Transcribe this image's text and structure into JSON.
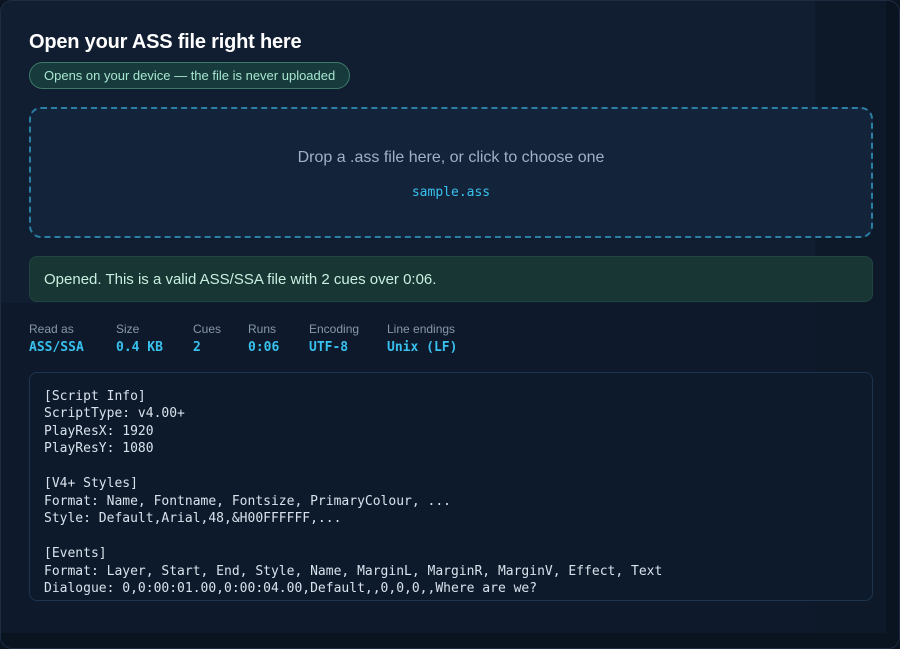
{
  "header": {
    "title": "Open your ASS file right here",
    "privacy_badge": "Opens on your device — the file is never uploaded"
  },
  "dropzone": {
    "prompt": "Drop a .ass file here, or click to choose one",
    "selected_file": "sample.ass"
  },
  "status": {
    "message": "Opened. This is a valid ASS/SSA file with 2 cues over 0:06."
  },
  "stats": [
    {
      "label": "Read as",
      "value": "ASS/SSA"
    },
    {
      "label": "Size",
      "value": "0.4 KB"
    },
    {
      "label": "Cues",
      "value": "2"
    },
    {
      "label": "Runs",
      "value": "0:06"
    },
    {
      "label": "Encoding",
      "value": "UTF-8"
    },
    {
      "label": "Line endings",
      "value": "Unix (LF)"
    }
  ],
  "file_preview": {
    "lines": [
      "[Script Info]",
      "ScriptType: v4.00+",
      "PlayResX: 1920",
      "PlayResY: 1080",
      "",
      "[V4+ Styles]",
      "Format: Name, Fontname, Fontsize, PrimaryColour, ...",
      "Style: Default,Arial,48,&H00FFFFFF,...",
      "",
      "[Events]",
      "Format: Layer, Start, End, Style, Name, MarginL, MarginR, MarginV, Effect, Text",
      "Dialogue: 0,0:00:01.00,0:00:04.00,Default,,0,0,0,,Where are we?"
    ]
  },
  "colors": {
    "accent": "#38c0ee",
    "success_bg": "#183634",
    "success_text": "#c8f0df",
    "panel_bg": "#111e31"
  }
}
